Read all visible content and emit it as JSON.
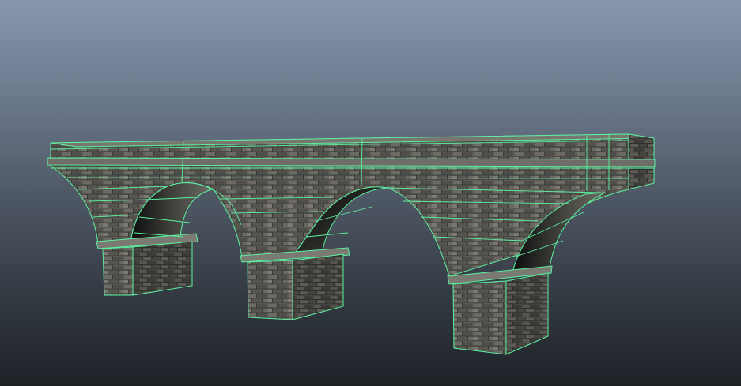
{
  "viewport": {
    "background_top": "#8797ad",
    "background_bottom": "#1e2227"
  },
  "model": {
    "object": "stone-arch-bridge",
    "arch_count": 3,
    "pier_count": 3,
    "selection_wireframe_color": "#5cf0a0",
    "stone_color": "#5e5d58"
  }
}
